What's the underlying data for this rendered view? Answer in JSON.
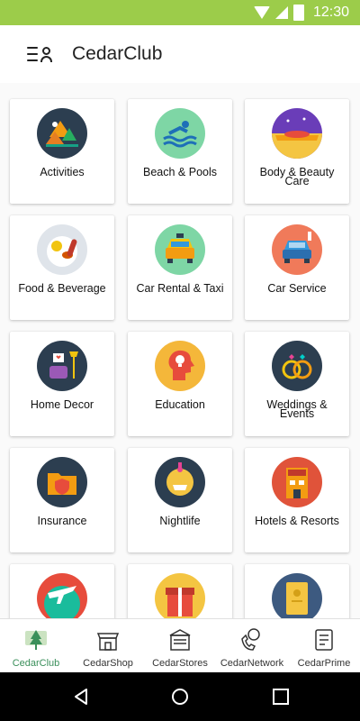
{
  "status": {
    "time": "12:30"
  },
  "app": {
    "title": "CedarClub"
  },
  "categories": [
    {
      "label": "Activities",
      "icon": "activities-icon"
    },
    {
      "label": "Beach & Pools",
      "icon": "beach-pools-icon"
    },
    {
      "label": "Body & Beauty Care",
      "icon": "body-beauty-care-icon"
    },
    {
      "label": "Food & Beverage",
      "icon": "food-beverage-icon"
    },
    {
      "label": "Car Rental & Taxi",
      "icon": "car-rental-taxi-icon"
    },
    {
      "label": "Car Service",
      "icon": "car-service-icon"
    },
    {
      "label": "Home Decor",
      "icon": "home-decor-icon"
    },
    {
      "label": "Education",
      "icon": "education-icon"
    },
    {
      "label": "Weddings & Events",
      "icon": "weddings-events-icon"
    },
    {
      "label": "Insurance",
      "icon": "insurance-icon"
    },
    {
      "label": "Nightlife",
      "icon": "nightlife-icon"
    },
    {
      "label": "Hotels & Resorts",
      "icon": "hotels-resorts-icon"
    },
    {
      "label": "",
      "icon": "travel-icon"
    },
    {
      "label": "",
      "icon": "gifts-icon"
    },
    {
      "label": "",
      "icon": "notebook-icon"
    }
  ],
  "bottom_nav": [
    {
      "label": "CedarClub",
      "icon": "cedarclub-icon",
      "active": true
    },
    {
      "label": "CedarShop",
      "icon": "shop-icon",
      "active": false
    },
    {
      "label": "CedarStores",
      "icon": "store-icon",
      "active": false
    },
    {
      "label": "CedarNetwork",
      "icon": "network-icon",
      "active": false
    },
    {
      "label": "CedarPrime",
      "icon": "prime-icon",
      "active": false
    }
  ],
  "colors": {
    "status_bar": "#9ccc4a",
    "active_tab": "#3a8f5a"
  }
}
